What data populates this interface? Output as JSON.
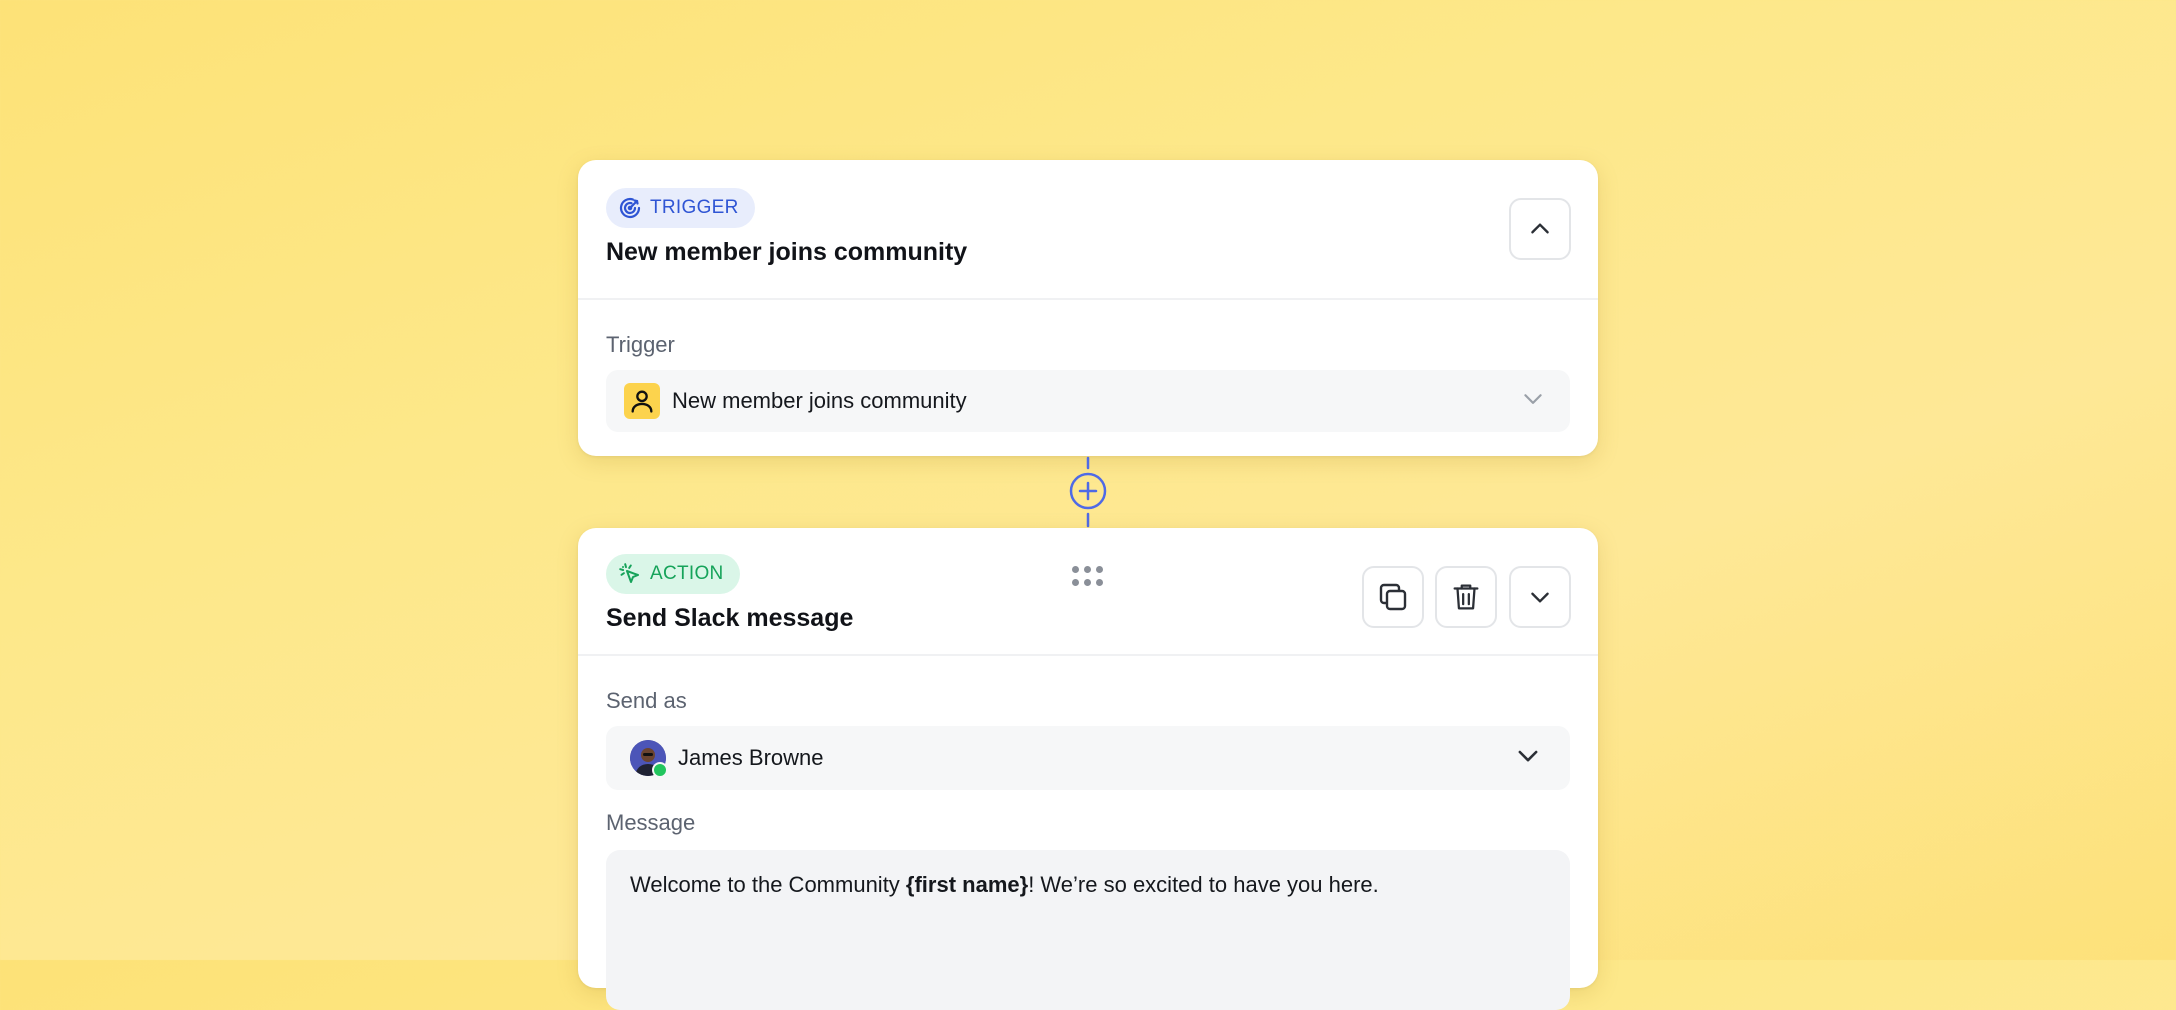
{
  "trigger_card": {
    "badge_label": "TRIGGER",
    "badge_icon": "target-icon",
    "title": "New member joins community",
    "collapse_icon": "chevron-up-icon",
    "field_label": "Trigger",
    "select_value": "New member joins community",
    "select_icon": "person-icon"
  },
  "connector": {
    "icon": "plus-circle-icon"
  },
  "action_card": {
    "badge_label": "ACTION",
    "badge_icon": "cursor-click-icon",
    "title": "Send Slack message",
    "buttons": [
      "copy-icon",
      "trash-icon",
      "chevron-down-icon"
    ],
    "send_as_label": "Send as",
    "send_as_value": "James Browne",
    "message_label": "Message",
    "message_prefix": "Welcome to the Community ",
    "message_variable": "{first name}",
    "message_suffix": "! We’re so excited to have you here."
  },
  "colors": {
    "background": "#fde277",
    "trigger_badge_bg": "#e8edfc",
    "trigger_badge_text": "#2f55d4",
    "action_badge_bg": "#daf6e8",
    "action_badge_text": "#16a35a",
    "connector": "#4f6ae6",
    "online": "#22c55e"
  }
}
